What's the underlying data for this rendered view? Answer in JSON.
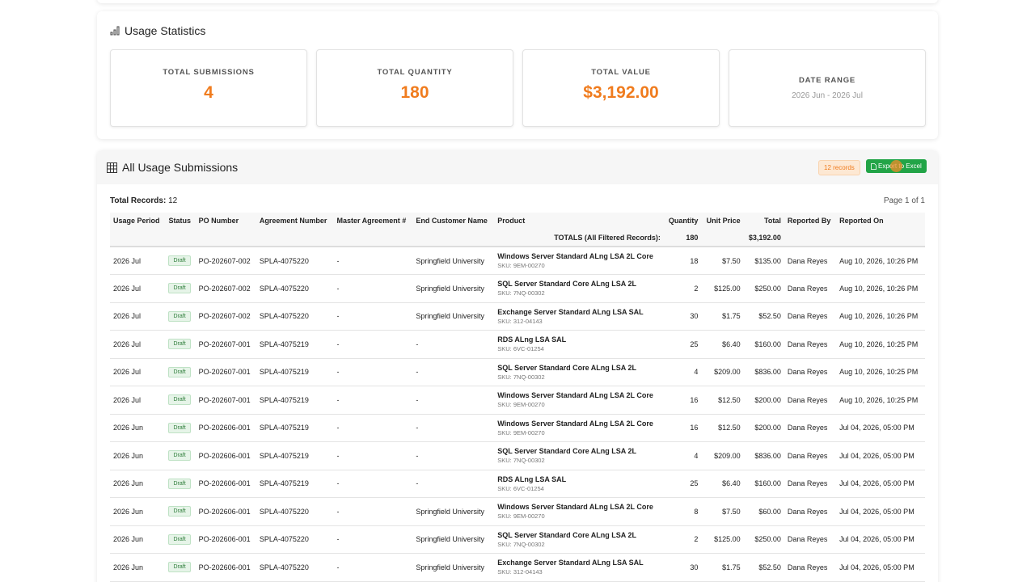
{
  "stats": {
    "title": "Usage Statistics",
    "boxes": [
      {
        "label": "TOTAL SUBMISSIONS",
        "value": "4"
      },
      {
        "label": "TOTAL QUANTITY",
        "value": "180"
      },
      {
        "label": "TOTAL VALUE",
        "value": "$3,192.00"
      },
      {
        "label": "DATE RANGE",
        "value": "2026 Jun - 2026 Jul"
      }
    ]
  },
  "submissions": {
    "title": "All Usage Submissions",
    "records_badge": "12 records",
    "export_label": "Export to Excel",
    "total_records_label": "Total Records:",
    "total_records_value": "12",
    "page_info": "Page 1 of 1",
    "columns": [
      "Usage Period",
      "Status",
      "PO Number",
      "Agreement Number",
      "Master Agreement #",
      "End Customer Name",
      "Product",
      "Quantity",
      "Unit Price",
      "Total",
      "Reported By",
      "Reported On"
    ],
    "totals": {
      "label": "TOTALS (All Filtered Records):",
      "quantity": "180",
      "total": "$3,192.00"
    },
    "rows": [
      {
        "period": "2026 Jul",
        "status": "Draft",
        "po": "PO-202607-002",
        "agreement": "SPLA-4075220",
        "master": "-",
        "customer": "Springfield University",
        "product": "Windows Server Standard ALng LSA 2L Core",
        "sku": "SKU: 9EM-00270",
        "qty": "18",
        "price": "$7.50",
        "total": "$135.00",
        "by": "Dana Reyes",
        "on": "Aug 10, 2026, 10:26 PM"
      },
      {
        "period": "2026 Jul",
        "status": "Draft",
        "po": "PO-202607-002",
        "agreement": "SPLA-4075220",
        "master": "-",
        "customer": "Springfield University",
        "product": "SQL Server Standard Core ALng LSA 2L",
        "sku": "SKU: 7NQ-00302",
        "qty": "2",
        "price": "$125.00",
        "total": "$250.00",
        "by": "Dana Reyes",
        "on": "Aug 10, 2026, 10:26 PM"
      },
      {
        "period": "2026 Jul",
        "status": "Draft",
        "po": "PO-202607-002",
        "agreement": "SPLA-4075220",
        "master": "-",
        "customer": "Springfield University",
        "product": "Exchange Server Standard ALng LSA SAL",
        "sku": "SKU: 312-04143",
        "qty": "30",
        "price": "$1.75",
        "total": "$52.50",
        "by": "Dana Reyes",
        "on": "Aug 10, 2026, 10:26 PM"
      },
      {
        "period": "2026 Jul",
        "status": "Draft",
        "po": "PO-202607-001",
        "agreement": "SPLA-4075219",
        "master": "-",
        "customer": "-",
        "product": "RDS ALng LSA SAL",
        "sku": "SKU: 6VC-01254",
        "qty": "25",
        "price": "$6.40",
        "total": "$160.00",
        "by": "Dana Reyes",
        "on": "Aug 10, 2026, 10:25 PM"
      },
      {
        "period": "2026 Jul",
        "status": "Draft",
        "po": "PO-202607-001",
        "agreement": "SPLA-4075219",
        "master": "-",
        "customer": "-",
        "product": "SQL Server Standard Core ALng LSA 2L",
        "sku": "SKU: 7NQ-00302",
        "qty": "4",
        "price": "$209.00",
        "total": "$836.00",
        "by": "Dana Reyes",
        "on": "Aug 10, 2026, 10:25 PM"
      },
      {
        "period": "2026 Jul",
        "status": "Draft",
        "po": "PO-202607-001",
        "agreement": "SPLA-4075219",
        "master": "-",
        "customer": "-",
        "product": "Windows Server Standard ALng LSA 2L Core",
        "sku": "SKU: 9EM-00270",
        "qty": "16",
        "price": "$12.50",
        "total": "$200.00",
        "by": "Dana Reyes",
        "on": "Aug 10, 2026, 10:25 PM"
      },
      {
        "period": "2026 Jun",
        "status": "Draft",
        "po": "PO-202606-001",
        "agreement": "SPLA-4075219",
        "master": "-",
        "customer": "-",
        "product": "Windows Server Standard ALng LSA 2L Core",
        "sku": "SKU: 9EM-00270",
        "qty": "16",
        "price": "$12.50",
        "total": "$200.00",
        "by": "Dana Reyes",
        "on": "Jul 04, 2026, 05:00 PM"
      },
      {
        "period": "2026 Jun",
        "status": "Draft",
        "po": "PO-202606-001",
        "agreement": "SPLA-4075219",
        "master": "-",
        "customer": "-",
        "product": "SQL Server Standard Core ALng LSA 2L",
        "sku": "SKU: 7NQ-00302",
        "qty": "4",
        "price": "$209.00",
        "total": "$836.00",
        "by": "Dana Reyes",
        "on": "Jul 04, 2026, 05:00 PM"
      },
      {
        "period": "2026 Jun",
        "status": "Draft",
        "po": "PO-202606-001",
        "agreement": "SPLA-4075219",
        "master": "-",
        "customer": "-",
        "product": "RDS ALng LSA SAL",
        "sku": "SKU: 6VC-01254",
        "qty": "25",
        "price": "$6.40",
        "total": "$160.00",
        "by": "Dana Reyes",
        "on": "Jul 04, 2026, 05:00 PM"
      },
      {
        "period": "2026 Jun",
        "status": "Draft",
        "po": "PO-202606-001",
        "agreement": "SPLA-4075220",
        "master": "-",
        "customer": "Springfield University",
        "product": "Windows Server Standard ALng LSA 2L Core",
        "sku": "SKU: 9EM-00270",
        "qty": "8",
        "price": "$7.50",
        "total": "$60.00",
        "by": "Dana Reyes",
        "on": "Jul 04, 2026, 05:00 PM"
      },
      {
        "period": "2026 Jun",
        "status": "Draft",
        "po": "PO-202606-001",
        "agreement": "SPLA-4075220",
        "master": "-",
        "customer": "Springfield University",
        "product": "SQL Server Standard Core ALng LSA 2L",
        "sku": "SKU: 7NQ-00302",
        "qty": "2",
        "price": "$125.00",
        "total": "$250.00",
        "by": "Dana Reyes",
        "on": "Jul 04, 2026, 05:00 PM"
      },
      {
        "period": "2026 Jun",
        "status": "Draft",
        "po": "PO-202606-001",
        "agreement": "SPLA-4075220",
        "master": "-",
        "customer": "Springfield University",
        "product": "Exchange Server Standard ALng LSA SAL",
        "sku": "SKU: 312-04143",
        "qty": "30",
        "price": "$1.75",
        "total": "$52.50",
        "by": "Dana Reyes",
        "on": "Jul 04, 2026, 05:00 PM"
      }
    ]
  }
}
